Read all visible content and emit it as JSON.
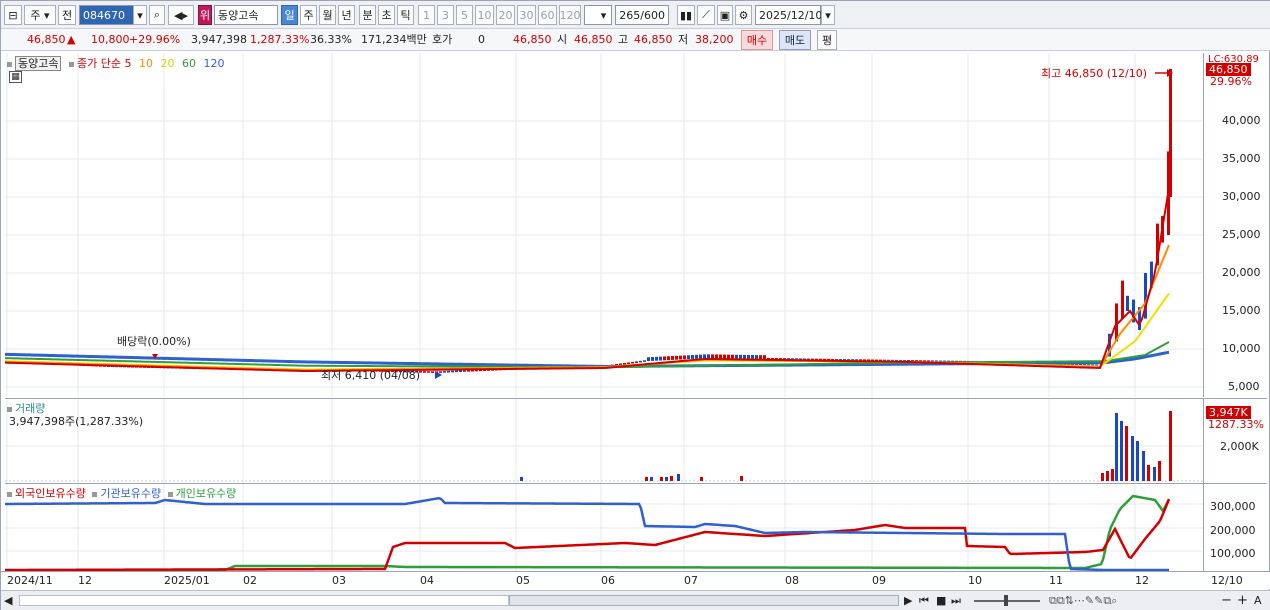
{
  "toolbar": {
    "market": "주",
    "prev_label": "전",
    "code": "084670",
    "stock_badge": "위",
    "stock_name": "동양고속",
    "periods": [
      "일",
      "주",
      "월",
      "년",
      "분",
      "초",
      "틱"
    ],
    "selected_period": "일",
    "minutes": [
      "1",
      "3",
      "5",
      "10",
      "20",
      "30",
      "60",
      "120"
    ],
    "count_value": "265",
    "count_max": "/600",
    "date": "2025/12/10"
  },
  "quote": {
    "price": "46,850",
    "change": "10,800",
    "change_pct": "+29.96%",
    "volume": "3,947,398",
    "volume_ratio": "1,287.33%",
    "turnover": "36.33%",
    "amount": "171,234백만",
    "hoga_label": "호가",
    "hoga_value": "0",
    "hoga_price": "46,850",
    "open_label": "시",
    "open": "46,850",
    "high_label": "고",
    "high": "46,850",
    "low_label": "저",
    "low": "38,200",
    "buy_label": "매수",
    "sell_label": "매도",
    "flat_label": "평"
  },
  "price_panel": {
    "stock_tag": "동양고속",
    "ma_title": "종가 단순",
    "ma_periods": [
      "5",
      "10",
      "20",
      "60",
      "120"
    ],
    "max_label": "최고 46,850 (12/10)",
    "min_label": "최저 6,410 (04/08)",
    "dividend_label": "배당락(0.00%)",
    "current_label": "46,850",
    "current_pct": "29.96%",
    "lc_label": "LC:630.89",
    "y_ticks": [
      "40,000",
      "35,000",
      "30,000",
      "25,000",
      "20,000",
      "15,000",
      "10,000",
      "5,000"
    ]
  },
  "volume_panel": {
    "title": "거래량",
    "summary": "3,947,398주(1,287.33%)",
    "current_label": "3,947K",
    "current_pct": "1287.33%",
    "y_ticks": [
      "2,000K"
    ]
  },
  "holdings_panel": {
    "series_names": [
      "외국인보유수량",
      "기관보유수량",
      "개인보유수량"
    ],
    "y_ticks": [
      "300,000",
      "200,000",
      "100,000"
    ]
  },
  "x_axis": {
    "labels": [
      "2024/11",
      "12",
      "2025/01",
      "02",
      "03",
      "04",
      "05",
      "06",
      "07",
      "08",
      "09",
      "10",
      "11",
      "12"
    ],
    "end_label": "12/10"
  },
  "colors": {
    "ma5": "#d40000",
    "ma10": "#ff8c00",
    "ma20": "#f0e000",
    "ma60": "#2e9e3a",
    "ma120": "#2f5fd0",
    "foreign": "#d40000",
    "institution": "#2f5fd0",
    "individual": "#2e9e3a",
    "up": "#d40000",
    "down": "#1848c8"
  }
}
